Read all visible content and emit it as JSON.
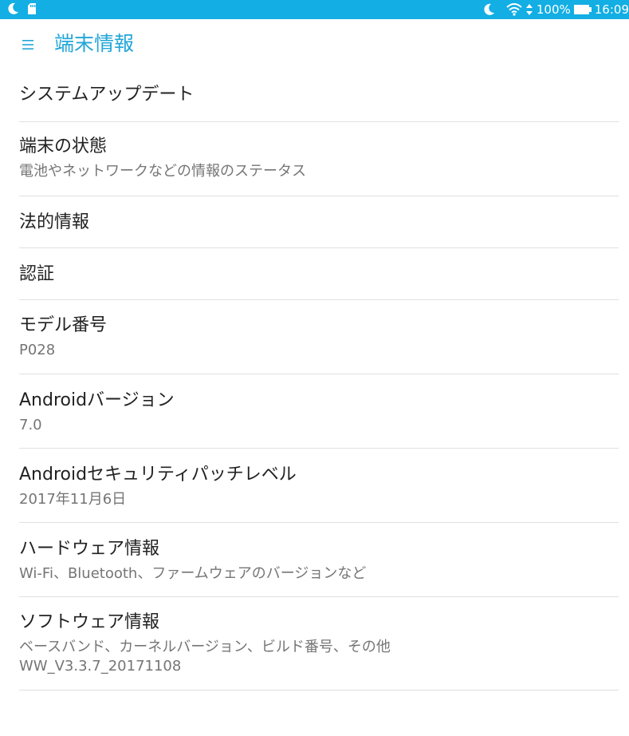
{
  "status_bar": {
    "left_icons": [
      "moon-icon",
      "sd-card-icon"
    ],
    "right_icons": [
      "moon-icon",
      "wifi-icon",
      "data-arrows-icon",
      "battery-icon"
    ],
    "battery": "100%",
    "time": "16:09"
  },
  "header": {
    "title": "端末情報",
    "menu_icon": "menu-icon",
    "accent_color": "#22a6d8",
    "status_color": "#12aee4"
  },
  "items": [
    {
      "title": "システムアップデート",
      "sub": []
    },
    {
      "title": "端末の状態",
      "sub": [
        "電池やネットワークなどの情報のステータス"
      ]
    },
    {
      "title": "法的情報",
      "sub": []
    },
    {
      "title": "認証",
      "sub": []
    },
    {
      "title": "モデル番号",
      "sub": [
        "P028"
      ]
    },
    {
      "title": "Androidバージョン",
      "sub": [
        "7.0"
      ]
    },
    {
      "title": "Androidセキュリティパッチレベル",
      "sub": [
        "2017年11月6日"
      ]
    },
    {
      "title": "ハードウェア情報",
      "sub": [
        "Wi-Fi、Bluetooth、ファームウェアのバージョンなど"
      ]
    },
    {
      "title": "ソフトウェア情報",
      "sub": [
        "ベースバンド、カーネルバージョン、ビルド番号、その他",
        "WW_V3.3.7_20171108"
      ]
    }
  ]
}
